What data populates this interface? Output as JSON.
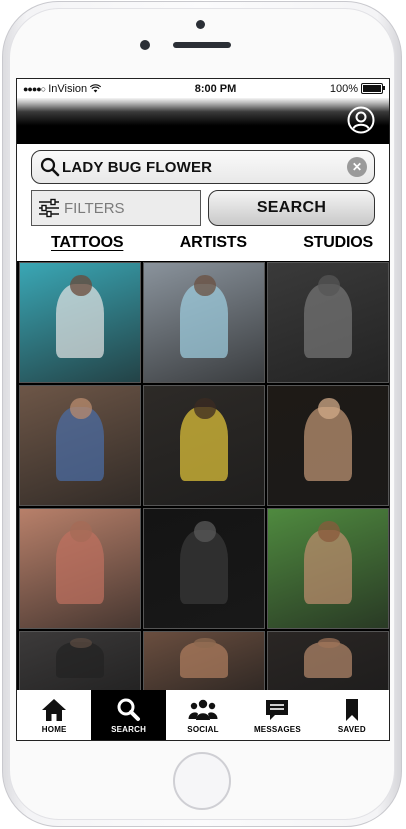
{
  "status_bar": {
    "carrier": "InVision",
    "time": "8:00 PM",
    "battery": "100%"
  },
  "search": {
    "query": "LADY BUG FLOWER"
  },
  "filters": {
    "label": "FILTERS"
  },
  "search_button": {
    "label": "SEARCH"
  },
  "tabs": [
    {
      "label": "TATTOOS",
      "active": true
    },
    {
      "label": "ARTISTS",
      "active": false
    },
    {
      "label": "STUDIOS",
      "active": false
    }
  ],
  "grid_photos": [
    {
      "bg": "#3aa7b5",
      "fig": "#e6e6e6",
      "head": "#6b4a3a"
    },
    {
      "bg": "#8a939c",
      "fig": "#9fd0e3",
      "head": "#6b5040"
    },
    {
      "bg": "#3a3a3a",
      "fig": "#777777",
      "head": "#555555"
    },
    {
      "bg": "#6d5647",
      "fig": "#4a6ea8",
      "head": "#b88b6e"
    },
    {
      "bg": "#2d2a27",
      "fig": "#e7c93a",
      "head": "#3b2b22"
    },
    {
      "bg": "#1e1a16",
      "fig": "#c49a78",
      "head": "#d0aa88"
    },
    {
      "bg": "#b8806a",
      "fig": "#c07060",
      "head": "#a56b57"
    },
    {
      "bg": "#141414",
      "fig": "#3a3a3a",
      "head": "#5a5a5a"
    },
    {
      "bg": "#4f8a3f",
      "fig": "#c08d6f",
      "head": "#8a5a3c"
    },
    {
      "bg": "#3c3a3a",
      "fig": "#222222",
      "head": "#5a4a40"
    },
    {
      "bg": "#6a4e3f",
      "fig": "#b07f5f",
      "head": "#8e6a50"
    },
    {
      "bg": "#2a2624",
      "fig": "#b78a6c",
      "head": "#9e7358"
    }
  ],
  "bottom_nav": [
    {
      "label": "HOME",
      "icon": "home-icon",
      "active": false
    },
    {
      "label": "SEARCH",
      "icon": "search-icon",
      "active": true
    },
    {
      "label": "SOCIAL",
      "icon": "social-icon",
      "active": false
    },
    {
      "label": "MESSAGES",
      "icon": "messages-icon",
      "active": false
    },
    {
      "label": "SAVED",
      "icon": "bookmark-icon",
      "active": false
    }
  ]
}
